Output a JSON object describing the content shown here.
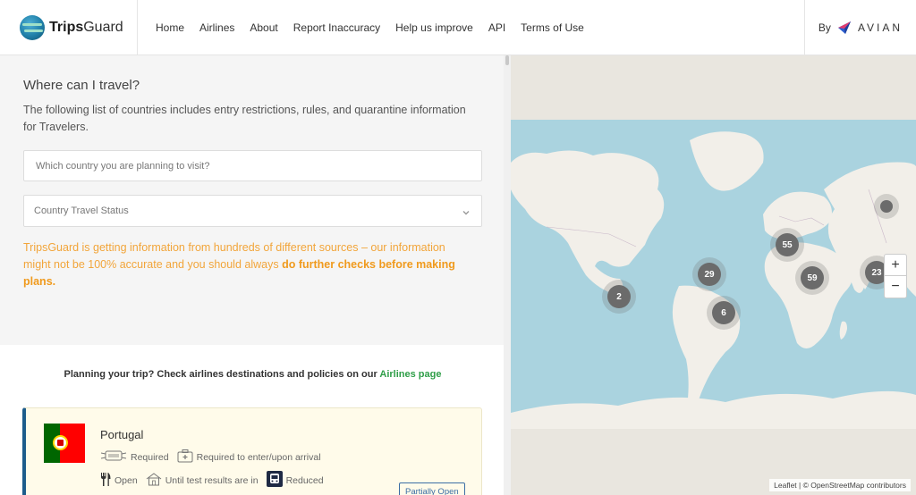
{
  "brand": {
    "name_bold": "Trips",
    "name_rest": "Guard"
  },
  "nav": [
    {
      "label": "Home"
    },
    {
      "label": "Airlines"
    },
    {
      "label": "About"
    },
    {
      "label": "Report Inaccuracy"
    },
    {
      "label": "Help us improve"
    },
    {
      "label": "API"
    },
    {
      "label": "Terms of Use"
    }
  ],
  "byline": {
    "by": "By",
    "partner": "AVIAN"
  },
  "search": {
    "title": "Where can I travel?",
    "description": "The following list of countries includes entry restrictions, rules, and quarantine information for Travelers.",
    "placeholder": "Which country you are planning to visit?",
    "status_select": "Country Travel Status"
  },
  "warning": {
    "text": "TripsGuard is getting information from hundreds of different sources – our information might not be 100% accurate and you should always ",
    "emphasis": "do further checks before making plans."
  },
  "airlines_prompt": {
    "text": "Planning your trip? Check airlines destinations and policies on our ",
    "link": "Airlines page"
  },
  "card": {
    "country": "Portugal",
    "mask": "Required",
    "test": "Required to enter/upon arrival",
    "restaurants": "Open",
    "quarantine": "Until test results are in",
    "transport": "Reduced",
    "status": "Partially Open"
  },
  "map": {
    "clusters": [
      {
        "count": "2"
      },
      {
        "count": "29"
      },
      {
        "count": "6"
      },
      {
        "count": "55"
      },
      {
        "count": "59"
      },
      {
        "count": "23"
      },
      {
        "count": ""
      }
    ],
    "zoom_in": "+",
    "zoom_out": "−",
    "attribution": "Leaflet | © OpenStreetMap contributors"
  },
  "colors": {
    "ocean": "#aad3df",
    "land": "#f2efe9",
    "warning": "#f2a53a",
    "link_green": "#2f9e48",
    "accent_blue": "#1d5c8c"
  }
}
